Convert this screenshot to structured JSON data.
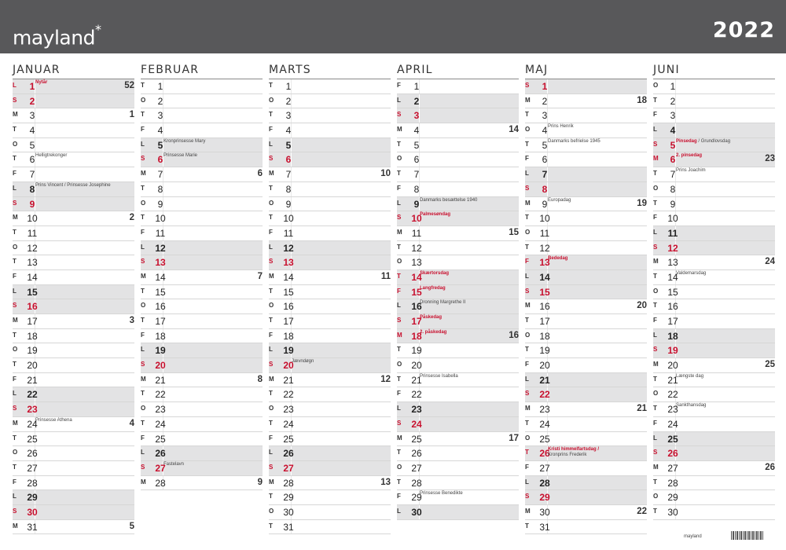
{
  "header": {
    "brand": "mayland",
    "brand_mark": "*",
    "year": "2022"
  },
  "colors": {
    "header_bg": "#58585a",
    "weekend_bg": "#e3e3e4",
    "holiday_red": "#c8102e"
  },
  "footer": {
    "logo": "mayland"
  },
  "months": [
    {
      "name": "JANUAR",
      "days": [
        {
          "wd": "L",
          "d": "1",
          "we": true,
          "red": true,
          "note": "Nytår",
          "note_red": true,
          "wk": "52"
        },
        {
          "wd": "S",
          "d": "2",
          "we": true,
          "red": true
        },
        {
          "wd": "M",
          "d": "3",
          "wk": "1"
        },
        {
          "wd": "T",
          "d": "4"
        },
        {
          "wd": "O",
          "d": "5"
        },
        {
          "wd": "T",
          "d": "6",
          "note": "Helligtrekonger"
        },
        {
          "wd": "F",
          "d": "7"
        },
        {
          "wd": "L",
          "d": "8",
          "we": true,
          "note": "Prins Vincent / Prinsesse Josephine"
        },
        {
          "wd": "S",
          "d": "9",
          "we": true,
          "red": true
        },
        {
          "wd": "M",
          "d": "10",
          "wk": "2"
        },
        {
          "wd": "T",
          "d": "11"
        },
        {
          "wd": "O",
          "d": "12"
        },
        {
          "wd": "T",
          "d": "13"
        },
        {
          "wd": "F",
          "d": "14"
        },
        {
          "wd": "L",
          "d": "15",
          "we": true
        },
        {
          "wd": "S",
          "d": "16",
          "we": true,
          "red": true
        },
        {
          "wd": "M",
          "d": "17",
          "wk": "3"
        },
        {
          "wd": "T",
          "d": "18"
        },
        {
          "wd": "O",
          "d": "19"
        },
        {
          "wd": "T",
          "d": "20"
        },
        {
          "wd": "F",
          "d": "21"
        },
        {
          "wd": "L",
          "d": "22",
          "we": true
        },
        {
          "wd": "S",
          "d": "23",
          "we": true,
          "red": true
        },
        {
          "wd": "M",
          "d": "24",
          "wk": "4",
          "note": "Prinsesse Athena"
        },
        {
          "wd": "T",
          "d": "25"
        },
        {
          "wd": "O",
          "d": "26"
        },
        {
          "wd": "T",
          "d": "27"
        },
        {
          "wd": "F",
          "d": "28"
        },
        {
          "wd": "L",
          "d": "29",
          "we": true
        },
        {
          "wd": "S",
          "d": "30",
          "we": true,
          "red": true
        },
        {
          "wd": "M",
          "d": "31",
          "wk": "5"
        }
      ]
    },
    {
      "name": "FEBRUAR",
      "days": [
        {
          "wd": "T",
          "d": "1"
        },
        {
          "wd": "O",
          "d": "2"
        },
        {
          "wd": "T",
          "d": "3"
        },
        {
          "wd": "F",
          "d": "4"
        },
        {
          "wd": "L",
          "d": "5",
          "we": true,
          "note": "Kronprinsesse Mary"
        },
        {
          "wd": "S",
          "d": "6",
          "we": true,
          "red": true,
          "note": "Prinsesse Marie"
        },
        {
          "wd": "M",
          "d": "7",
          "wk": "6"
        },
        {
          "wd": "T",
          "d": "8"
        },
        {
          "wd": "O",
          "d": "9"
        },
        {
          "wd": "T",
          "d": "10"
        },
        {
          "wd": "F",
          "d": "11"
        },
        {
          "wd": "L",
          "d": "12",
          "we": true
        },
        {
          "wd": "S",
          "d": "13",
          "we": true,
          "red": true
        },
        {
          "wd": "M",
          "d": "14",
          "wk": "7"
        },
        {
          "wd": "T",
          "d": "15"
        },
        {
          "wd": "O",
          "d": "16"
        },
        {
          "wd": "T",
          "d": "17"
        },
        {
          "wd": "F",
          "d": "18"
        },
        {
          "wd": "L",
          "d": "19",
          "we": true
        },
        {
          "wd": "S",
          "d": "20",
          "we": true,
          "red": true
        },
        {
          "wd": "M",
          "d": "21",
          "wk": "8"
        },
        {
          "wd": "T",
          "d": "22"
        },
        {
          "wd": "O",
          "d": "23"
        },
        {
          "wd": "T",
          "d": "24"
        },
        {
          "wd": "F",
          "d": "25"
        },
        {
          "wd": "L",
          "d": "26",
          "we": true
        },
        {
          "wd": "S",
          "d": "27",
          "we": true,
          "red": true,
          "note": "Fastelavn"
        },
        {
          "wd": "M",
          "d": "28",
          "wk": "9"
        }
      ]
    },
    {
      "name": "MARTS",
      "days": [
        {
          "wd": "T",
          "d": "1"
        },
        {
          "wd": "O",
          "d": "2"
        },
        {
          "wd": "T",
          "d": "3"
        },
        {
          "wd": "F",
          "d": "4"
        },
        {
          "wd": "L",
          "d": "5",
          "we": true
        },
        {
          "wd": "S",
          "d": "6",
          "we": true,
          "red": true
        },
        {
          "wd": "M",
          "d": "7",
          "wk": "10"
        },
        {
          "wd": "T",
          "d": "8"
        },
        {
          "wd": "O",
          "d": "9"
        },
        {
          "wd": "T",
          "d": "10"
        },
        {
          "wd": "F",
          "d": "11"
        },
        {
          "wd": "L",
          "d": "12",
          "we": true
        },
        {
          "wd": "S",
          "d": "13",
          "we": true,
          "red": true
        },
        {
          "wd": "M",
          "d": "14",
          "wk": "11"
        },
        {
          "wd": "T",
          "d": "15"
        },
        {
          "wd": "O",
          "d": "16"
        },
        {
          "wd": "T",
          "d": "17"
        },
        {
          "wd": "F",
          "d": "18"
        },
        {
          "wd": "L",
          "d": "19",
          "we": true
        },
        {
          "wd": "S",
          "d": "20",
          "we": true,
          "red": true,
          "note": "Jævndøgn"
        },
        {
          "wd": "M",
          "d": "21",
          "wk": "12"
        },
        {
          "wd": "T",
          "d": "22"
        },
        {
          "wd": "O",
          "d": "23"
        },
        {
          "wd": "T",
          "d": "24"
        },
        {
          "wd": "F",
          "d": "25"
        },
        {
          "wd": "L",
          "d": "26",
          "we": true
        },
        {
          "wd": "S",
          "d": "27",
          "we": true,
          "red": true
        },
        {
          "wd": "M",
          "d": "28",
          "wk": "13"
        },
        {
          "wd": "T",
          "d": "29"
        },
        {
          "wd": "O",
          "d": "30"
        },
        {
          "wd": "T",
          "d": "31"
        }
      ]
    },
    {
      "name": "APRIL",
      "days": [
        {
          "wd": "F",
          "d": "1"
        },
        {
          "wd": "L",
          "d": "2",
          "we": true
        },
        {
          "wd": "S",
          "d": "3",
          "we": true,
          "red": true
        },
        {
          "wd": "M",
          "d": "4",
          "wk": "14"
        },
        {
          "wd": "T",
          "d": "5"
        },
        {
          "wd": "O",
          "d": "6"
        },
        {
          "wd": "T",
          "d": "7"
        },
        {
          "wd": "F",
          "d": "8"
        },
        {
          "wd": "L",
          "d": "9",
          "we": true,
          "note": "Danmarks besættelse 1940"
        },
        {
          "wd": "S",
          "d": "10",
          "we": true,
          "red": true,
          "note": "Palmesøndag",
          "note_red": true
        },
        {
          "wd": "M",
          "d": "11",
          "wk": "15"
        },
        {
          "wd": "T",
          "d": "12"
        },
        {
          "wd": "O",
          "d": "13"
        },
        {
          "wd": "T",
          "d": "14",
          "we": true,
          "red": true,
          "note": "Skærtorsdag",
          "note_red": true
        },
        {
          "wd": "F",
          "d": "15",
          "we": true,
          "red": true,
          "note": "Langfredag",
          "note_red": true
        },
        {
          "wd": "L",
          "d": "16",
          "we": true,
          "note": "Dronning Margrethe II"
        },
        {
          "wd": "S",
          "d": "17",
          "we": true,
          "red": true,
          "note": "Påskedag",
          "note_red": true
        },
        {
          "wd": "M",
          "d": "18",
          "we": true,
          "red": true,
          "wk": "16",
          "note": "2. påskedag",
          "note_red": true
        },
        {
          "wd": "T",
          "d": "19"
        },
        {
          "wd": "O",
          "d": "20"
        },
        {
          "wd": "T",
          "d": "21",
          "note": "Prinsesse Isabella"
        },
        {
          "wd": "F",
          "d": "22"
        },
        {
          "wd": "L",
          "d": "23",
          "we": true
        },
        {
          "wd": "S",
          "d": "24",
          "we": true,
          "red": true
        },
        {
          "wd": "M",
          "d": "25",
          "wk": "17"
        },
        {
          "wd": "T",
          "d": "26"
        },
        {
          "wd": "O",
          "d": "27"
        },
        {
          "wd": "T",
          "d": "28"
        },
        {
          "wd": "F",
          "d": "29",
          "note": "Prinsesse Benedikte"
        },
        {
          "wd": "L",
          "d": "30",
          "we": true
        }
      ]
    },
    {
      "name": "MAJ",
      "days": [
        {
          "wd": "S",
          "d": "1",
          "we": true,
          "red": true
        },
        {
          "wd": "M",
          "d": "2",
          "wk": "18"
        },
        {
          "wd": "T",
          "d": "3"
        },
        {
          "wd": "O",
          "d": "4",
          "note": "Prins Henrik"
        },
        {
          "wd": "T",
          "d": "5",
          "note": "Danmarks befrielse 1945"
        },
        {
          "wd": "F",
          "d": "6"
        },
        {
          "wd": "L",
          "d": "7",
          "we": true
        },
        {
          "wd": "S",
          "d": "8",
          "we": true,
          "red": true
        },
        {
          "wd": "M",
          "d": "9",
          "wk": "19",
          "note": "Europadag"
        },
        {
          "wd": "T",
          "d": "10"
        },
        {
          "wd": "O",
          "d": "11"
        },
        {
          "wd": "T",
          "d": "12"
        },
        {
          "wd": "F",
          "d": "13",
          "we": true,
          "red": true,
          "note": "Bededag",
          "note_red": true
        },
        {
          "wd": "L",
          "d": "14",
          "we": true
        },
        {
          "wd": "S",
          "d": "15",
          "we": true,
          "red": true
        },
        {
          "wd": "M",
          "d": "16",
          "wk": "20"
        },
        {
          "wd": "T",
          "d": "17"
        },
        {
          "wd": "O",
          "d": "18"
        },
        {
          "wd": "T",
          "d": "19"
        },
        {
          "wd": "F",
          "d": "20"
        },
        {
          "wd": "L",
          "d": "21",
          "we": true
        },
        {
          "wd": "S",
          "d": "22",
          "we": true,
          "red": true
        },
        {
          "wd": "M",
          "d": "23",
          "wk": "21"
        },
        {
          "wd": "T",
          "d": "24"
        },
        {
          "wd": "O",
          "d": "25"
        },
        {
          "wd": "T",
          "d": "26",
          "we": true,
          "red": true,
          "note": "Kristi himmelfartsdag /",
          "note_red": true,
          "note2": "Kronprins Frederik"
        },
        {
          "wd": "F",
          "d": "27"
        },
        {
          "wd": "L",
          "d": "28",
          "we": true
        },
        {
          "wd": "S",
          "d": "29",
          "we": true,
          "red": true
        },
        {
          "wd": "M",
          "d": "30",
          "wk": "22"
        },
        {
          "wd": "T",
          "d": "31"
        }
      ]
    },
    {
      "name": "JUNI",
      "days": [
        {
          "wd": "O",
          "d": "1"
        },
        {
          "wd": "T",
          "d": "2"
        },
        {
          "wd": "F",
          "d": "3"
        },
        {
          "wd": "L",
          "d": "4",
          "we": true
        },
        {
          "wd": "S",
          "d": "5",
          "we": true,
          "red": true,
          "note": "Pinsedag",
          "note_red": true,
          "note_tail": " / Grundlovsdag"
        },
        {
          "wd": "M",
          "d": "6",
          "we": true,
          "red": true,
          "wk": "23",
          "note": "2. pinsedag",
          "note_red": true
        },
        {
          "wd": "T",
          "d": "7",
          "note": "Prins Joachim"
        },
        {
          "wd": "O",
          "d": "8"
        },
        {
          "wd": "T",
          "d": "9"
        },
        {
          "wd": "F",
          "d": "10"
        },
        {
          "wd": "L",
          "d": "11",
          "we": true
        },
        {
          "wd": "S",
          "d": "12",
          "we": true,
          "red": true
        },
        {
          "wd": "M",
          "d": "13",
          "wk": "24"
        },
        {
          "wd": "T",
          "d": "14",
          "note": "Valdemarsdag"
        },
        {
          "wd": "O",
          "d": "15"
        },
        {
          "wd": "T",
          "d": "16"
        },
        {
          "wd": "F",
          "d": "17"
        },
        {
          "wd": "L",
          "d": "18",
          "we": true
        },
        {
          "wd": "S",
          "d": "19",
          "we": true,
          "red": true
        },
        {
          "wd": "M",
          "d": "20",
          "wk": "25"
        },
        {
          "wd": "T",
          "d": "21",
          "note": "Længste dag"
        },
        {
          "wd": "O",
          "d": "22"
        },
        {
          "wd": "T",
          "d": "23",
          "note": "Sankthansdag"
        },
        {
          "wd": "F",
          "d": "24"
        },
        {
          "wd": "L",
          "d": "25",
          "we": true
        },
        {
          "wd": "S",
          "d": "26",
          "we": true,
          "red": true
        },
        {
          "wd": "M",
          "d": "27",
          "wk": "26"
        },
        {
          "wd": "T",
          "d": "28"
        },
        {
          "wd": "O",
          "d": "29"
        },
        {
          "wd": "T",
          "d": "30"
        }
      ]
    }
  ]
}
